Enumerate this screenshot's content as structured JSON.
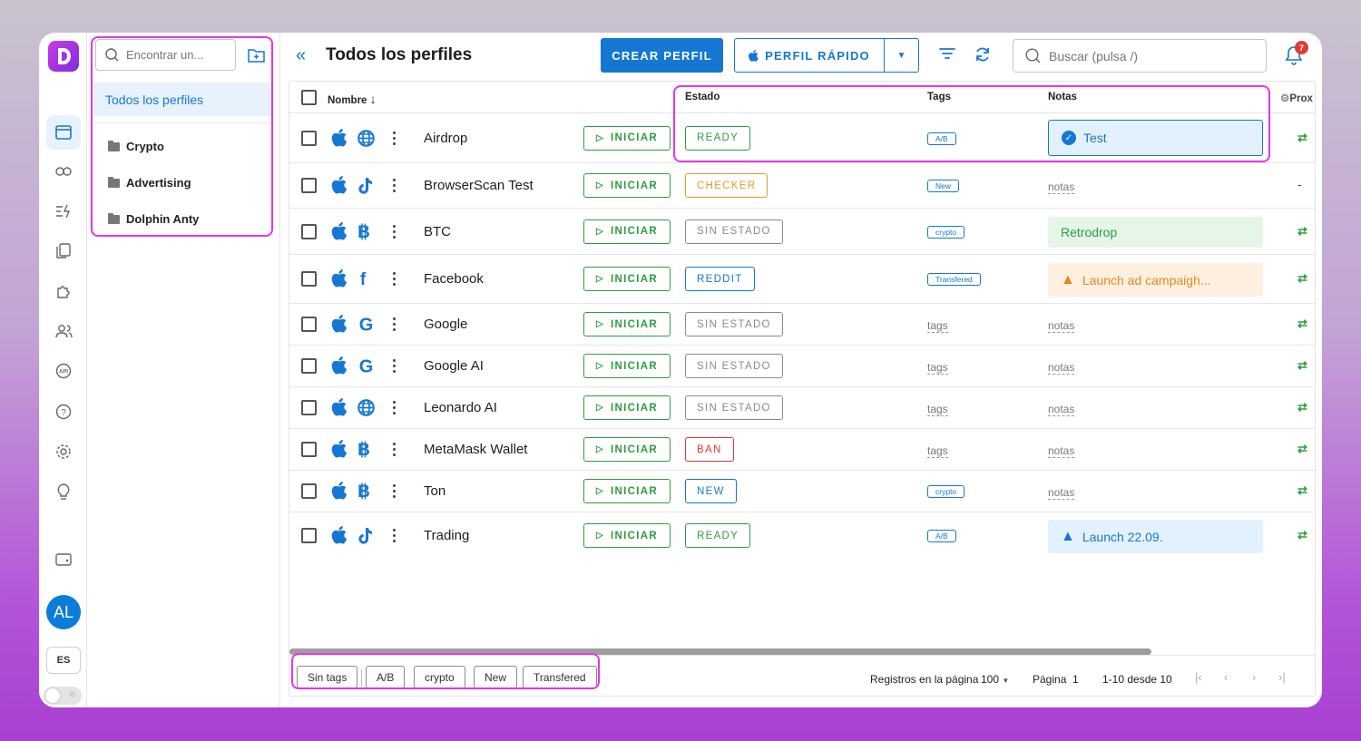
{
  "folders": {
    "search_placeholder": "Encontrar un...",
    "all_profiles": "Todos los perfiles",
    "items": [
      "Crypto",
      "Advertising",
      "Dolphin Anty"
    ]
  },
  "header": {
    "title": "Todos los perfiles",
    "create_label": "CREAR PERFIL",
    "quick_label": "PERFIL RÁPIDO",
    "search_placeholder": "Buscar (pulsa /)",
    "notification_count": "7"
  },
  "table": {
    "columns": {
      "name": "Nombre",
      "status": "Estado",
      "tags": "Tags",
      "notes": "Notas",
      "proxy": "Prox"
    },
    "start_label": "INICIAR",
    "tags_placeholder": "tags",
    "notes_placeholder": "notas",
    "rows": [
      {
        "name": "Airdrop",
        "icon2": "globe-icon",
        "status": "READY",
        "tag": "A/B",
        "note": "Test",
        "note_style": "info-check",
        "proxy": "⇄"
      },
      {
        "name": "BrowserScan Test",
        "icon2": "tiktok-icon",
        "status": "CHECKER",
        "tag": "New",
        "note": "",
        "proxy": "-"
      },
      {
        "name": "BTC",
        "icon2": "bitcoin-icon",
        "status": "SIN ESTADO",
        "tag": "crypto",
        "note": "Retrodrop",
        "note_style": "green",
        "proxy": "⇄"
      },
      {
        "name": "Facebook",
        "icon2": "facebook-icon",
        "status": "REDDIT",
        "tag": "Transfered",
        "note": "Launch ad campaigh...",
        "note_style": "warning",
        "proxy": "⇄"
      },
      {
        "name": "Google",
        "icon2": "google-icon",
        "status": "SIN ESTADO",
        "tag": "",
        "note": "",
        "proxy": "⇄"
      },
      {
        "name": "Google AI",
        "icon2": "google-icon",
        "status": "SIN ESTADO",
        "tag": "",
        "note": "",
        "proxy": "⇄"
      },
      {
        "name": "Leonardo AI",
        "icon2": "globe-icon",
        "status": "SIN ESTADO",
        "tag": "",
        "note": "",
        "proxy": "⇄"
      },
      {
        "name": "MetaMask Wallet",
        "icon2": "bitcoin-icon",
        "status": "BAN",
        "tag": "",
        "note": "",
        "proxy": "⇄"
      },
      {
        "name": "Ton",
        "icon2": "bitcoin-icon",
        "status": "NEW",
        "tag": "crypto",
        "note": "",
        "proxy": "⇄"
      },
      {
        "name": "Trading",
        "icon2": "tiktok-icon",
        "status": "READY",
        "tag": "A/B",
        "note": "Launch 22.09.",
        "note_style": "info-warning",
        "proxy": "⇄"
      }
    ]
  },
  "footer": {
    "tag_chips": [
      "Sin tags",
      "A/B",
      "crypto",
      "New",
      "Transfered"
    ],
    "records_label": "Registros en la página",
    "records_value": "100",
    "page_label": "Página",
    "page_value": "1",
    "range": "1-10 desde 10"
  },
  "sidebar": {
    "avatar": "AL",
    "lang": "ES"
  },
  "colors": {
    "accent": "#1677d2",
    "start_green": "#2e9d3f",
    "highlight": "#e635e6",
    "status": {
      "READY": "#2e9d3f",
      "CHECKER": "#f0962b",
      "SIN ESTADO": "#8a8a8a",
      "REDDIT": "#1677d2",
      "BAN": "#e53935",
      "NEW": "#1677d2"
    }
  }
}
